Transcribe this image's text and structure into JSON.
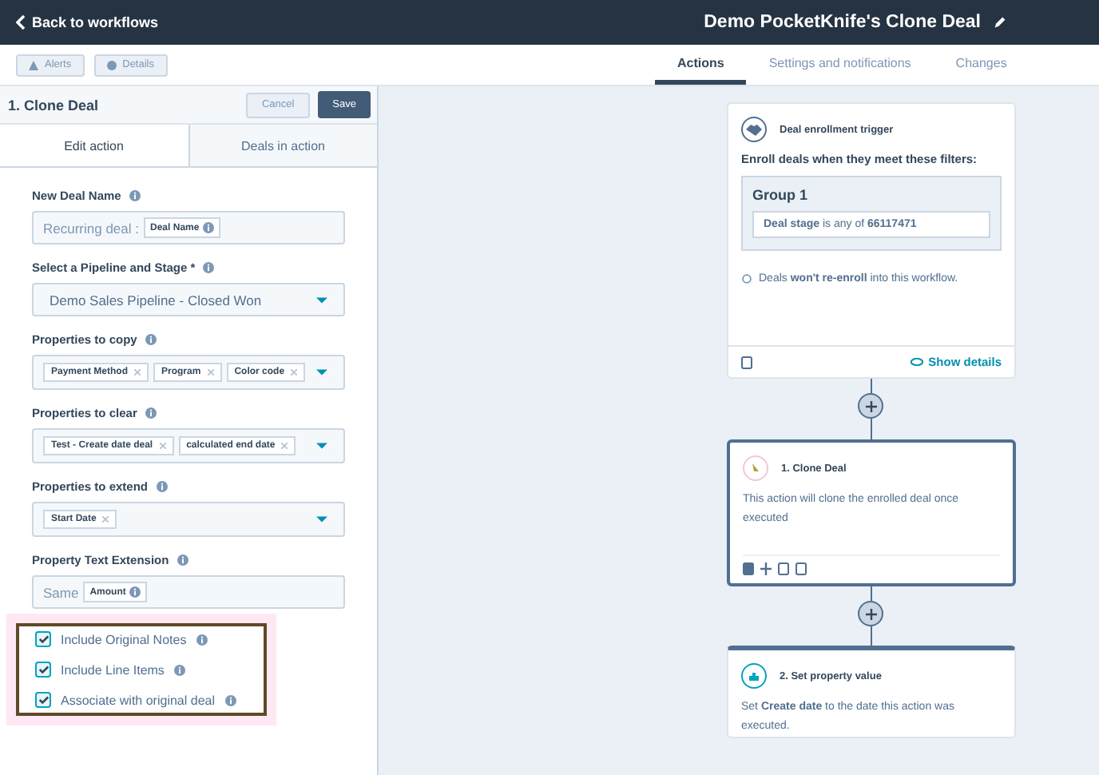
{
  "header": {
    "back": "Back to workflows",
    "title": "Demo PocketKnife's Clone Deal"
  },
  "toolbar": {
    "buttons": [
      "Alerts",
      "Details"
    ]
  },
  "tabs": [
    {
      "label": "Actions",
      "selected": true
    },
    {
      "label": "Settings and notifications",
      "selected": false
    },
    {
      "label": "Changes",
      "selected": false
    }
  ],
  "panel": {
    "title": "1. Clone Deal",
    "cancel": "Cancel",
    "save": "Save",
    "tabs": [
      {
        "label": "Edit action",
        "selected": true
      },
      {
        "label": "Deals in action",
        "selected": false
      }
    ],
    "fields": [
      {
        "kind": "token",
        "label": "New Deal Name",
        "prefix": "Recurring deal :",
        "token": "Deal Name"
      },
      {
        "kind": "select",
        "label": "Select a Pipeline and Stage *",
        "value": "Demo Sales Pipeline - Closed Won"
      },
      {
        "kind": "tags",
        "label": "Properties to copy",
        "tags": [
          "Payment Method",
          "Program",
          "Color code"
        ]
      },
      {
        "kind": "tags",
        "label": "Properties to clear",
        "tags": [
          "Test - Create date deal",
          "calculated end date"
        ]
      },
      {
        "kind": "tags",
        "label": "Properties to extend",
        "tags": [
          "Start Date"
        ]
      },
      {
        "kind": "token",
        "label": "Property Text Extension",
        "prefix": "Same",
        "token": "Amount"
      }
    ],
    "checkboxes": [
      {
        "label": "Include Original Notes",
        "checked": true
      },
      {
        "label": "Include Line Items",
        "checked": true
      },
      {
        "label": "Associate with original deal",
        "checked": true
      }
    ]
  },
  "canvas": {
    "trigger": {
      "title": "Deal enrollment trigger",
      "intro": "Enroll deals when they meet these filters:",
      "group": "Group 1",
      "filter": "**Deal stage** is any of **66117471**",
      "reenroll": "Deals **won't re-enroll** into this workflow.",
      "show_details": "Show details"
    },
    "actions": [
      {
        "title": "1. Clone Deal",
        "text": "This action will clone the enrolled deal once executed",
        "selected": true
      },
      {
        "title": "2. Set property value",
        "text": "Set **Create date** to the date this action was executed.",
        "selected": false
      }
    ]
  }
}
